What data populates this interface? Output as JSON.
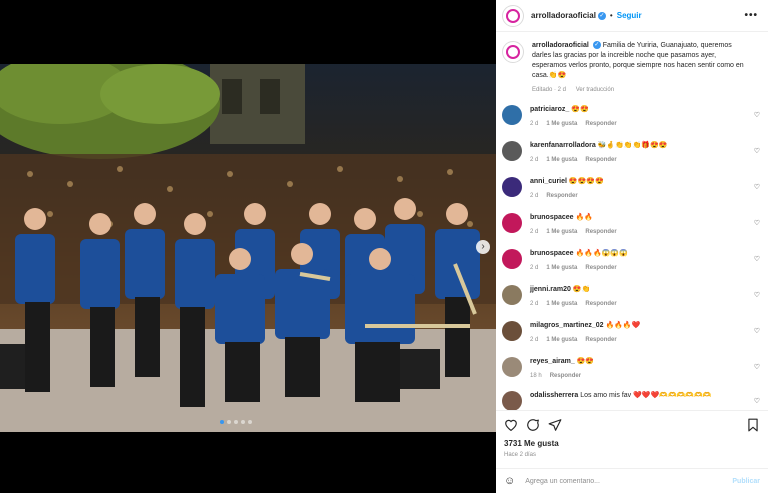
{
  "post": {
    "username": "arrolladoraoficial",
    "follow_label": "Seguir",
    "more_label": "•••",
    "caption_user": "arrolladoraoficial",
    "caption_text": "Familia de Yuriria, Guanajuato, queremos darles las gracias por la increible noche que pasamos ayer, esperamos verlos pronto, porque siempre nos hacen sentir como en casa.👏😍",
    "caption_meta": "Editado · 2 d",
    "translate_label": "Ver traducción",
    "likes": "3731 Me gusta",
    "time": "Hace 2 días",
    "add_comment_placeholder": "Agrega un comentario...",
    "publish_label": "Publicar"
  },
  "comments": [
    {
      "user": "patriciaroz_",
      "text": "😍😍",
      "age": "2 d",
      "likes": "1 Me gusta",
      "reply": "Responder",
      "color": "#2f6fa8"
    },
    {
      "user": "karenfanarrolladora",
      "text": "🐝🤞👏👏👏🎁😍😍",
      "age": "2 d",
      "likes": "1 Me gusta",
      "reply": "Responder",
      "color": "#5a5a5a"
    },
    {
      "user": "anni_curiel",
      "text": "😍😍😍😍",
      "age": "2 d",
      "likes": "",
      "reply": "Responder",
      "color": "#3b2a7a"
    },
    {
      "user": "brunospacee",
      "text": "🔥🔥",
      "age": "2 d",
      "likes": "1 Me gusta",
      "reply": "Responder",
      "color": "#c2185b"
    },
    {
      "user": "brunospacee",
      "text": "🔥🔥🔥😱😱😱",
      "age": "2 d",
      "likes": "1 Me gusta",
      "reply": "Responder",
      "color": "#c2185b"
    },
    {
      "user": "jjenni.ram20",
      "text": "😍👏",
      "age": "2 d",
      "likes": "1 Me gusta",
      "reply": "Responder",
      "color": "#8a7a60"
    },
    {
      "user": "milagros_martinez_02",
      "text": "🔥🔥🔥❤️",
      "age": "2 d",
      "likes": "1 Me gusta",
      "reply": "Responder",
      "color": "#6b4f3a"
    },
    {
      "user": "reyes_airam_",
      "text": "😍😍",
      "age": "18 h",
      "likes": "",
      "reply": "Responder",
      "color": "#9a8a78"
    },
    {
      "user": "odalissherrera",
      "text": "Los amo mis fav ❤️❤️❤️🫶🫶🫶🫶🫶🫶",
      "age": "",
      "likes": "",
      "reply": "",
      "color": "#7a5a4a"
    }
  ]
}
